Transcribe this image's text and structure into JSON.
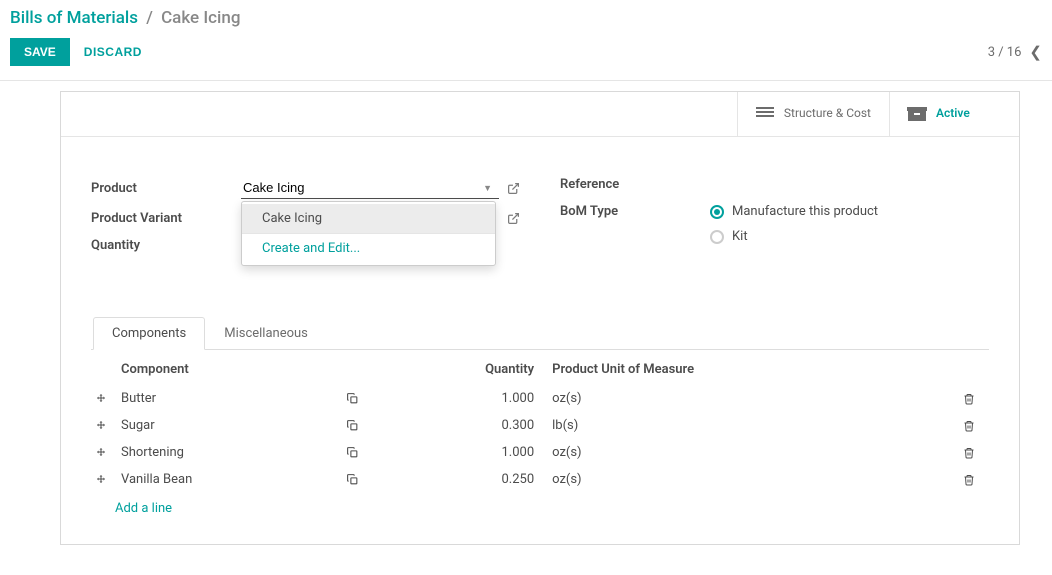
{
  "breadcrumb": {
    "root": "Bills of Materials",
    "sep": "/",
    "current": "Cake Icing"
  },
  "actions": {
    "save": "SAVE",
    "discard": "DISCARD"
  },
  "pager": {
    "text": "3 / 16"
  },
  "stat_buttons": {
    "structure_cost": "Structure & Cost",
    "active": "Active"
  },
  "form": {
    "product_label": "Product",
    "product_value": "Cake Icing",
    "variant_label": "Product Variant",
    "quantity_label": "Quantity",
    "reference_label": "Reference",
    "bom_type_label": "BoM Type",
    "bom_type_options": {
      "manufacture": "Manufacture this product",
      "kit": "Kit"
    }
  },
  "dropdown": {
    "option1": "Cake Icing",
    "create_edit": "Create and Edit..."
  },
  "tabs": {
    "components": "Components",
    "misc": "Miscellaneous"
  },
  "table": {
    "headers": {
      "component": "Component",
      "qty": "Quantity",
      "uom": "Product Unit of Measure"
    },
    "rows": [
      {
        "name": "Butter",
        "qty": "1.000",
        "uom": "oz(s)"
      },
      {
        "name": "Sugar",
        "qty": "0.300",
        "uom": "lb(s)"
      },
      {
        "name": "Shortening",
        "qty": "1.000",
        "uom": "oz(s)"
      },
      {
        "name": "Vanilla Bean",
        "qty": "0.250",
        "uom": "oz(s)"
      }
    ],
    "add_line": "Add a line"
  }
}
